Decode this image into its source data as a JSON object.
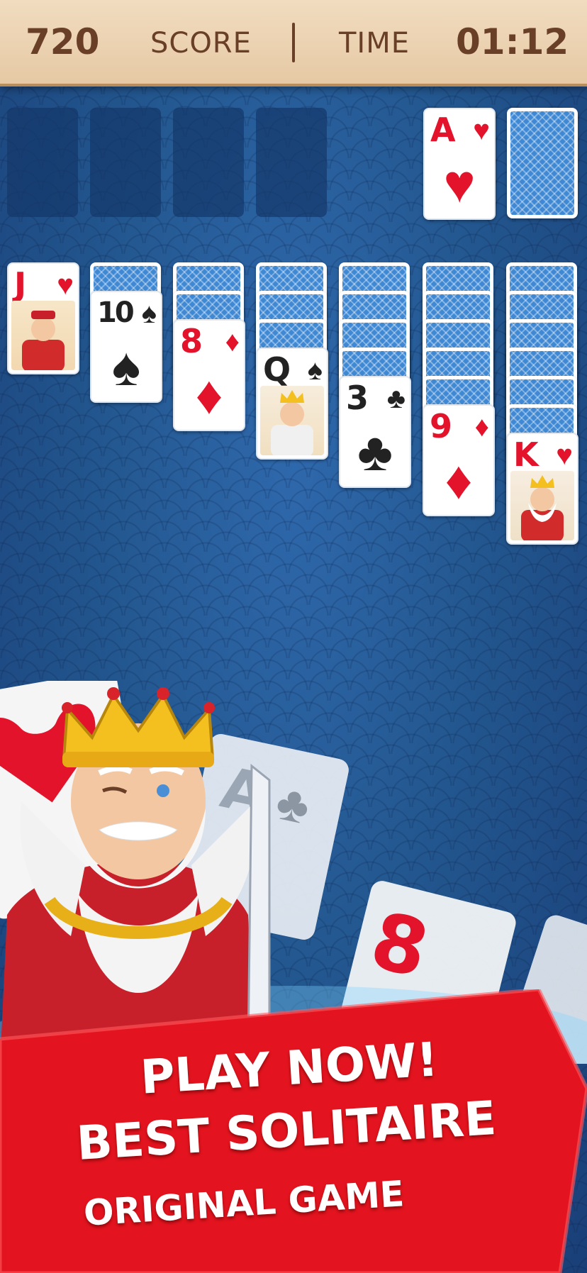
{
  "hud": {
    "score_value": "720",
    "score_label": "SCORE",
    "time_label": "TIME",
    "time_value": "01:12"
  },
  "foundations": {
    "ace_rank": "A",
    "ace_suit": "♥"
  },
  "stock": {
    "label": "face-down stock pile"
  },
  "tableau": [
    {
      "rank": "J",
      "suit": "♥",
      "color": "red",
      "face": "jack",
      "hidden": 0
    },
    {
      "rank": "10",
      "suit": "♠",
      "color": "black",
      "face": null,
      "hidden": 1
    },
    {
      "rank": "8",
      "suit": "♦",
      "color": "red",
      "face": null,
      "hidden": 2
    },
    {
      "rank": "Q",
      "suit": "♠",
      "color": "black",
      "face": "queen",
      "hidden": 3
    },
    {
      "rank": "3",
      "suit": "♣",
      "color": "black",
      "face": null,
      "hidden": 4
    },
    {
      "rank": "9",
      "suit": "♦",
      "color": "red",
      "face": null,
      "hidden": 5
    },
    {
      "rank": "K",
      "suit": "♥",
      "color": "red",
      "face": "king",
      "hidden": 6
    }
  ],
  "promo": {
    "line1": "PLAY NOW!",
    "line2": "BEST SOLITAIRE",
    "line3": "ORIGINAL GAME",
    "bg_card_1": "A",
    "bg_card_2": "8"
  },
  "colors": {
    "red_suit": "#e2132a",
    "black_suit": "#222222",
    "banner_red": "#e3141f",
    "table_blue": "#23578f",
    "hud_brown": "#6a3f27"
  }
}
